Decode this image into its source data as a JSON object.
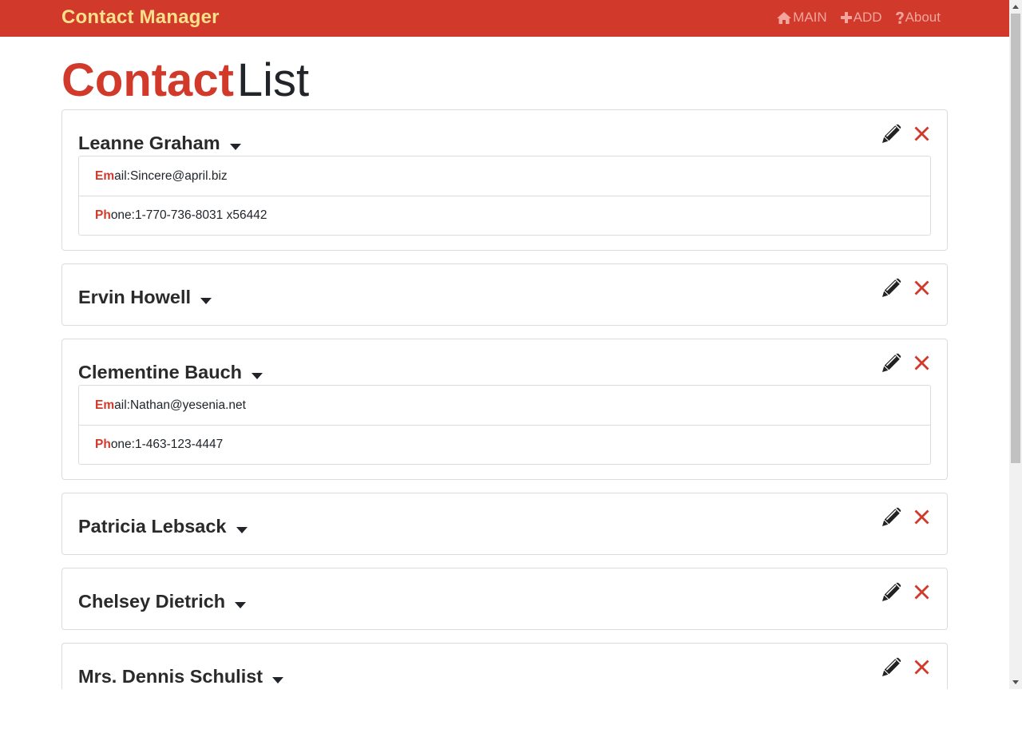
{
  "app": {
    "brand": "Contact Manager"
  },
  "nav": [
    {
      "label": "MAIN",
      "icon": "home-icon"
    },
    {
      "label": "ADD",
      "icon": "plus-icon"
    },
    {
      "label": "About",
      "icon": "question-icon"
    }
  ],
  "page": {
    "title_strong": "Contact",
    "title_light": "List"
  },
  "labels": {
    "email_prefix": "Em",
    "email_rest": "ail: ",
    "phone_prefix": "Ph",
    "phone_rest": "one: "
  },
  "contacts": [
    {
      "name": "Leanne Graham",
      "expanded": true,
      "email": "Sincere@april.biz",
      "phone": "1-770-736-8031 x56442"
    },
    {
      "name": "Ervin Howell",
      "expanded": false
    },
    {
      "name": "Clementine Bauch",
      "expanded": true,
      "email": "Nathan@yesenia.net",
      "phone": "1-463-123-4447"
    },
    {
      "name": "Patricia Lebsack",
      "expanded": false
    },
    {
      "name": "Chelsey Dietrich",
      "expanded": false
    },
    {
      "name": "Mrs. Dennis Schulist",
      "expanded": false
    }
  ],
  "colors": {
    "brand": "#d13a2b",
    "brand_text": "#fbe08c",
    "nav_text": "#f1a59d",
    "delete": "#d13a2b"
  },
  "icons": {
    "edit": "pencil-icon",
    "delete": "close-icon",
    "toggle": "caret-down-icon"
  }
}
